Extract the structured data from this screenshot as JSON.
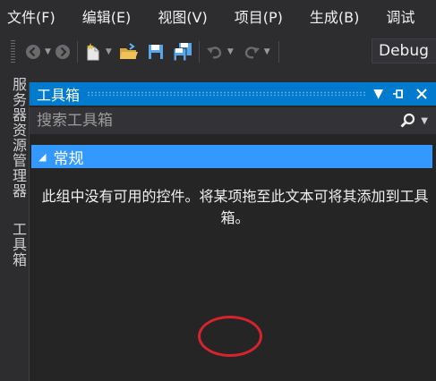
{
  "menu": [
    "文件(F)",
    "编辑(E)",
    "视图(V)",
    "项目(P)",
    "生成(B)",
    "调试"
  ],
  "toolbar": {
    "icons": [
      "back-icon",
      "forward-icon",
      "new-project-icon",
      "open-folder-icon",
      "save-icon",
      "save-all-icon",
      "undo-icon",
      "redo-icon"
    ],
    "configuration": "Debug"
  },
  "side_tabs": [
    "服务器资源管理器",
    "工具箱"
  ],
  "toolbox": {
    "title": "工具箱",
    "search_placeholder": "搜索工具箱",
    "group_label": "常规",
    "empty_message": "此组中没有可用的控件。将某项拖至此文本可将其添加到工具箱。"
  },
  "colors": {
    "background": "#2d2d30",
    "accent": "#007acc",
    "group_highlight": "#3399ff",
    "annotation": "#d6242a"
  }
}
